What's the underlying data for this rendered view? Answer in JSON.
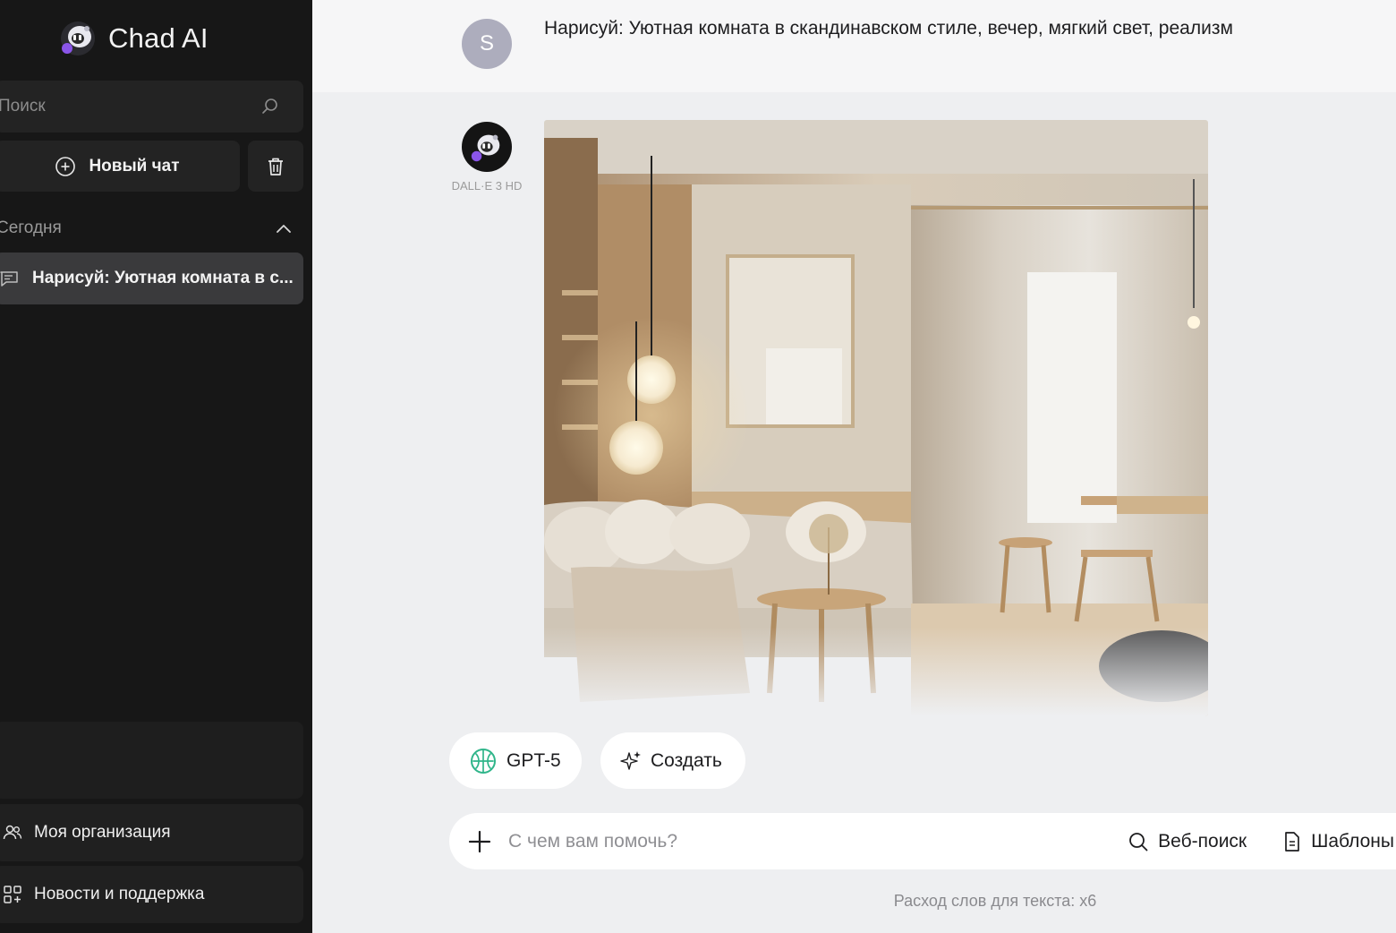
{
  "brand": {
    "name": "Chad AI"
  },
  "sidebar": {
    "search_placeholder": "Поиск",
    "new_chat_label": "Новый чат",
    "section_title": "Сегодня",
    "chats": [
      {
        "title": "Нарисуй: Уютная комната в с..."
      }
    ],
    "bottom_items": [
      {
        "label": "Моя организация",
        "icon": "users-icon"
      },
      {
        "label": "Новости и поддержка",
        "icon": "apps-icon"
      }
    ]
  },
  "conversation": {
    "user_initial": "S",
    "user_message": "Нарисуй: Уютная комната в скандинавском стиле, вечер, мягкий свет, реализм",
    "bot_model_label": "DALL·E 3 HD"
  },
  "composer": {
    "model_pill": "GPT-5",
    "create_pill": "Создать",
    "placeholder": "С чем вам помочь?",
    "web_search_label": "Веб-поиск",
    "templates_label": "Шаблоны",
    "footnote": "Расход слов для текста: x6"
  },
  "colors": {
    "sidebar_bg": "#171717",
    "sidebar_item_active": "#3a3a3c",
    "main_bg": "#eeeff1",
    "gpt_icon": "#2fb58a"
  }
}
